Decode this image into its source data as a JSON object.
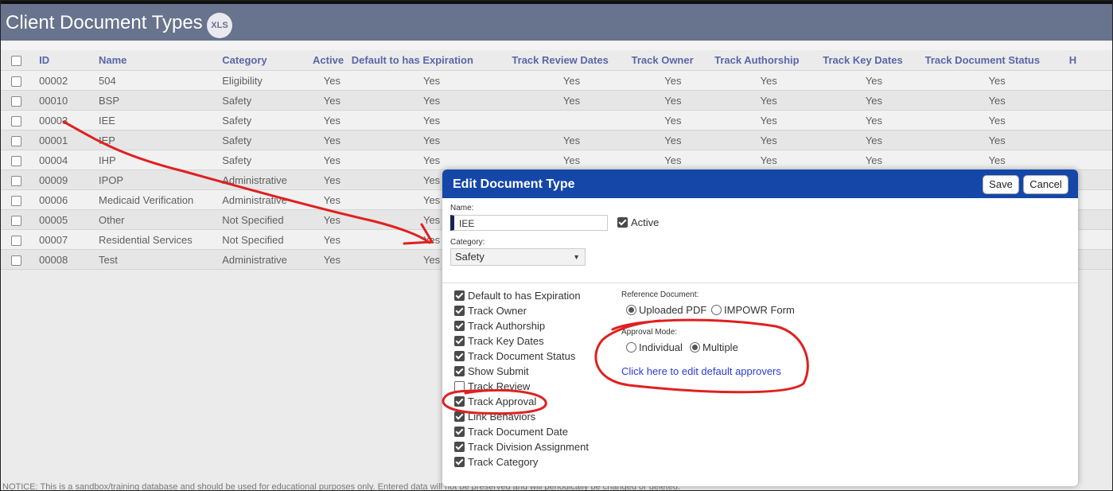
{
  "page": {
    "title": "Client Document Types",
    "xls_badge": "XLS"
  },
  "table": {
    "columns": [
      "ID",
      "Name",
      "Category",
      "Active",
      "Default to has Expiration",
      "Track Review Dates",
      "Track Owner",
      "Track Authorship",
      "Track Key Dates",
      "Track Document Status",
      "H"
    ],
    "rows": [
      [
        "00002",
        "504",
        "Eligibility",
        "Yes",
        "Yes",
        "Yes",
        "Yes",
        "Yes",
        "Yes",
        "Yes"
      ],
      [
        "00010",
        "BSP",
        "Safety",
        "Yes",
        "Yes",
        "Yes",
        "Yes",
        "Yes",
        "Yes",
        "Yes"
      ],
      [
        "00003",
        "IEE",
        "Safety",
        "Yes",
        "Yes",
        "",
        "Yes",
        "Yes",
        "Yes",
        "Yes"
      ],
      [
        "00001",
        "IEP",
        "Safety",
        "Yes",
        "Yes",
        "Yes",
        "Yes",
        "Yes",
        "Yes",
        "Yes"
      ],
      [
        "00004",
        "IHP",
        "Safety",
        "Yes",
        "Yes",
        "Yes",
        "Yes",
        "Yes",
        "Yes",
        "Yes"
      ],
      [
        "00009",
        "IPOP",
        "Administrative",
        "Yes",
        "Yes",
        "",
        "",
        "",
        "",
        ""
      ],
      [
        "00006",
        "Medicaid Verification",
        "Administrative",
        "Yes",
        "Yes",
        "",
        "",
        "",
        "",
        ""
      ],
      [
        "00005",
        "Other",
        "Not Specified",
        "Yes",
        "Yes",
        "",
        "",
        "",
        "",
        ""
      ],
      [
        "00007",
        "Residential Services",
        "Not Specified",
        "Yes",
        "Yes",
        "",
        "",
        "",
        "",
        ""
      ],
      [
        "00008",
        "Test",
        "Administrative",
        "Yes",
        "Yes",
        "",
        "",
        "",
        "",
        ""
      ]
    ]
  },
  "notice": "NOTICE: This is a sandbox/training database and should be used for educational purposes only. Entered data will not be preserved and will periodically be changed or deleted.",
  "modal": {
    "title": "Edit Document Type",
    "save_label": "Save",
    "cancel_label": "Cancel",
    "name_label": "Name:",
    "name_value": "IEE",
    "active_label": "Active",
    "category_label": "Category:",
    "category_value": "Safety",
    "options": [
      {
        "label": "Default to has Expiration",
        "checked": true
      },
      {
        "label": "Track Owner",
        "checked": true
      },
      {
        "label": "Track Authorship",
        "checked": true
      },
      {
        "label": "Track Key Dates",
        "checked": true
      },
      {
        "label": "Track Document Status",
        "checked": true
      },
      {
        "label": "Show Submit",
        "checked": true
      },
      {
        "label": "Track Review",
        "checked": false
      },
      {
        "label": "Track Approval",
        "checked": true
      },
      {
        "label": "Link Behaviors",
        "checked": true
      },
      {
        "label": "Track Document Date",
        "checked": true
      },
      {
        "label": "Track Division Assignment",
        "checked": true
      },
      {
        "label": "Track Category",
        "checked": true
      }
    ],
    "reference_label": "Reference Document:",
    "reference_options": [
      "Uploaded PDF",
      "IMPOWR Form"
    ],
    "reference_selected": "Uploaded PDF",
    "approval_label": "Approval Mode:",
    "approval_options": [
      "Individual",
      "Multiple"
    ],
    "approval_selected": "Multiple",
    "approvers_link": "Click here to edit default approvers"
  },
  "colors": {
    "header_bg": "#68738d",
    "modal_header_bg": "#1447a8",
    "column_header_text": "#5a66a8",
    "annotation_red": "#e02020",
    "link": "#2a3bd6"
  }
}
